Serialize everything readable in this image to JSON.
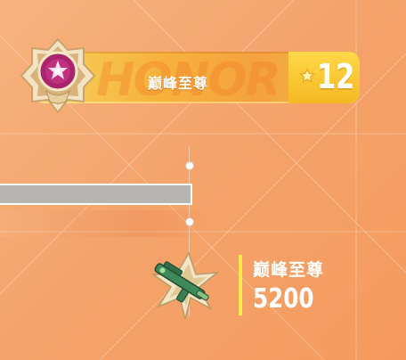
{
  "rank_banner": {
    "title": "巅峰至尊",
    "watermark": "HONOR",
    "stars": "12",
    "icons": {
      "emblem": "rank-emblem-icon",
      "star": "star-icon"
    }
  },
  "progress": {
    "fill_fraction": 1.0
  },
  "reward": {
    "title": "巅峰至尊",
    "points": "5200",
    "icon": "gun-reward-icon"
  },
  "colors": {
    "background": "#f5a46b",
    "banner_gold": "#f7b13b",
    "star_panel": "#ffd84a",
    "accent_yellow": "#ffe94a",
    "emblem_magenta": "#a8246e",
    "bar_gray": "#b7b5b4"
  }
}
